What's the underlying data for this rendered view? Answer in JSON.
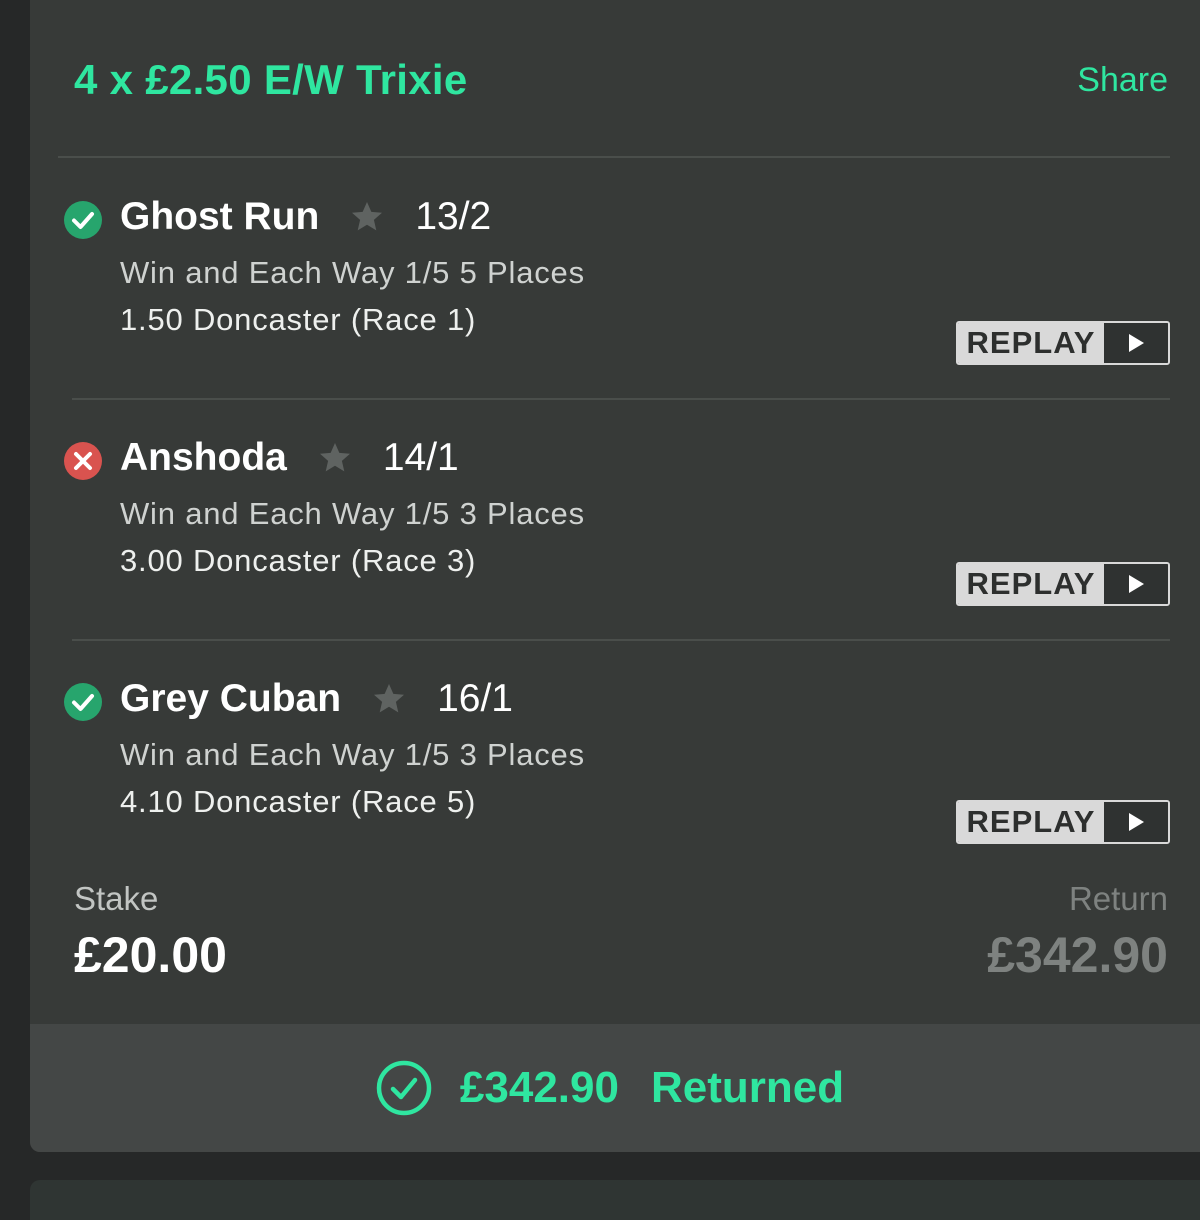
{
  "bet": {
    "title": "4 x £2.50 E/W Trixie",
    "share_label": "Share"
  },
  "selections": [
    {
      "status": "won",
      "status_icon": "check-circle-icon",
      "horse": "Ghost Run",
      "odds": "13/2",
      "market": "Win and Each Way 1/5 5 Places",
      "race": "1.50 Doncaster (Race 1)",
      "replay_label": "REPLAY"
    },
    {
      "status": "lost",
      "status_icon": "cross-circle-icon",
      "horse": "Anshoda",
      "odds": "14/1",
      "market": "Win and Each Way 1/5 3 Places",
      "race": "3.00 Doncaster (Race 3)",
      "replay_label": "REPLAY"
    },
    {
      "status": "won",
      "status_icon": "check-circle-icon",
      "horse": "Grey Cuban",
      "odds": "16/1",
      "market": "Win and Each Way 1/5 3 Places",
      "race": "4.10 Doncaster (Race 5)",
      "replay_label": "REPLAY"
    }
  ],
  "summary": {
    "stake_label": "Stake",
    "stake_value": "£20.00",
    "return_label": "Return",
    "return_value": "£342.90"
  },
  "result": {
    "amount": "£342.90",
    "label": "Returned"
  },
  "colors": {
    "accent": "#2fe6a0",
    "won": "#27a56d",
    "lost": "#d9534f",
    "card_bg": "#373a38"
  }
}
